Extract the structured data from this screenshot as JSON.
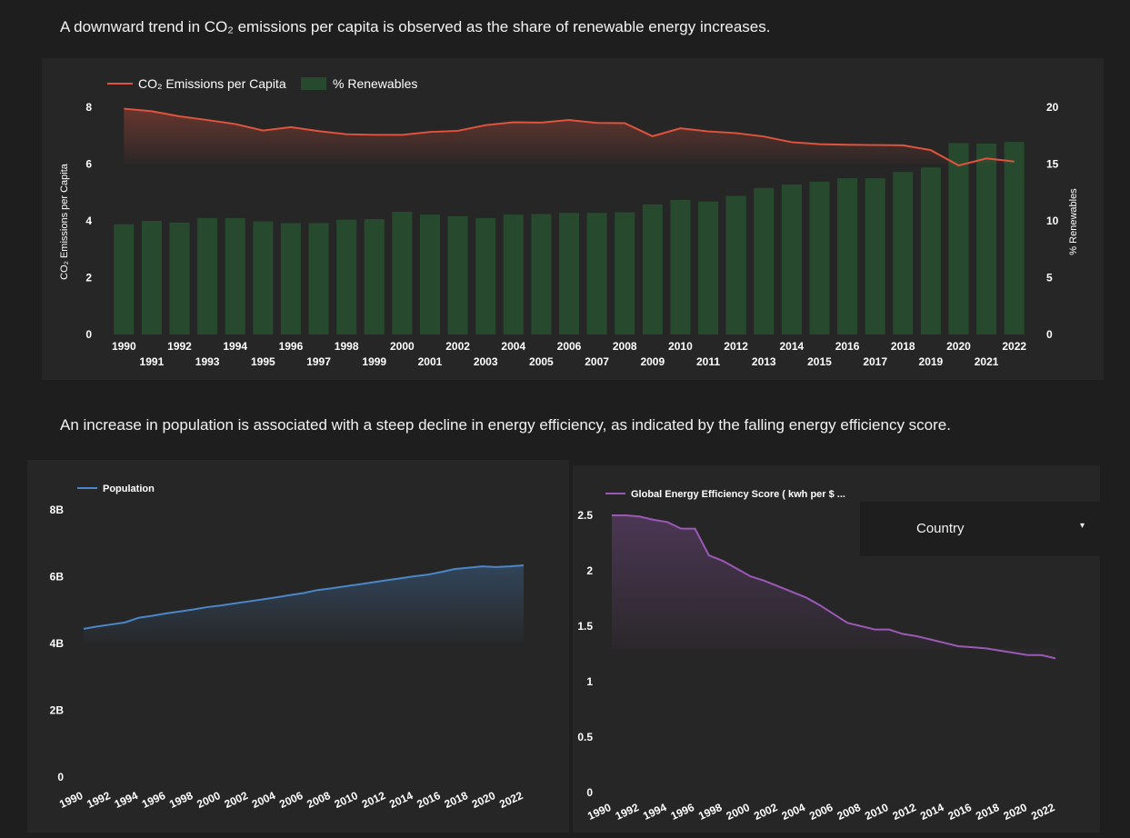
{
  "captions": {
    "top": "A downward trend in CO₂ emissions per capita is observed as the share of renewable energy increases.",
    "bottom": "An increase in population is associated with a  steep decline in energy efficiency, as indicated by the falling energy efficiency score."
  },
  "filter": {
    "label": "Country",
    "caret": "▾"
  },
  "colors": {
    "emissions_line": "#e0533d",
    "renewables_bar": "#274a2f",
    "population_line": "#4a86c8",
    "efficiency_line": "#9b59b6"
  },
  "chart_data": [
    {
      "type": "bar-line-combo",
      "title": "",
      "legend_position": "top-left",
      "categories": [
        "1990",
        "1991",
        "1992",
        "1993",
        "1994",
        "1995",
        "1996",
        "1997",
        "1998",
        "1999",
        "2000",
        "2001",
        "2002",
        "2003",
        "2004",
        "2005",
        "2006",
        "2007",
        "2008",
        "2009",
        "2010",
        "2011",
        "2012",
        "2013",
        "2014",
        "2015",
        "2016",
        "2017",
        "2018",
        "2019",
        "2020",
        "2021",
        "2022"
      ],
      "series": [
        {
          "name": "CO₂ Emissions per Capita",
          "type": "line",
          "axis": "left",
          "values": [
            7.95,
            7.86,
            7.68,
            7.55,
            7.41,
            7.18,
            7.3,
            7.16,
            7.05,
            7.03,
            7.03,
            7.13,
            7.17,
            7.37,
            7.47,
            7.46,
            7.55,
            7.45,
            7.44,
            6.98,
            7.26,
            7.15,
            7.09,
            6.97,
            6.77,
            6.7,
            6.68,
            6.67,
            6.66,
            6.49,
            5.95,
            6.2,
            6.09
          ]
        },
        {
          "name": "% Renewables",
          "type": "bar",
          "axis": "right",
          "values": [
            9.7,
            10.0,
            9.85,
            10.25,
            10.25,
            9.95,
            9.8,
            9.8,
            10.1,
            10.15,
            10.8,
            10.55,
            10.4,
            10.25,
            10.55,
            10.6,
            10.7,
            10.7,
            10.75,
            11.45,
            11.85,
            11.7,
            12.2,
            12.9,
            13.2,
            13.45,
            13.75,
            13.75,
            14.3,
            14.7,
            16.85,
            16.8,
            16.95
          ]
        }
      ],
      "y_left": {
        "label": "CO₂ Emissions per Capita",
        "ylim": [
          0,
          8
        ],
        "ticks": [
          "0",
          "2",
          "4",
          "6",
          "8"
        ]
      },
      "y_right": {
        "label": "% Renewables",
        "ylim": [
          0,
          20
        ],
        "ticks": [
          "0",
          "5",
          "10",
          "15",
          "20"
        ]
      }
    },
    {
      "type": "area",
      "title": "",
      "legend_position": "top-left",
      "x": [
        "1990",
        "1991",
        "1992",
        "1993",
        "1994",
        "1995",
        "1996",
        "1997",
        "1998",
        "1999",
        "2000",
        "2001",
        "2002",
        "2003",
        "2004",
        "2005",
        "2006",
        "2007",
        "2008",
        "2009",
        "2010",
        "2011",
        "2012",
        "2013",
        "2014",
        "2015",
        "2016",
        "2017",
        "2018",
        "2019",
        "2020",
        "2021",
        "2022"
      ],
      "x_ticks": [
        "1990",
        "1992",
        "1994",
        "1996",
        "1998",
        "2000",
        "2002",
        "2004",
        "2006",
        "2008",
        "2010",
        "2012",
        "2014",
        "2016",
        "2018",
        "2020",
        "2022"
      ],
      "series": [
        {
          "name": "Population",
          "values": [
            4.44,
            4.51,
            4.57,
            4.63,
            4.77,
            4.83,
            4.9,
            4.96,
            5.02,
            5.09,
            5.14,
            5.2,
            5.26,
            5.32,
            5.38,
            5.45,
            5.51,
            5.6,
            5.65,
            5.71,
            5.77,
            5.83,
            5.89,
            5.95,
            6.01,
            6.06,
            6.14,
            6.23,
            6.27,
            6.31,
            6.29,
            6.31,
            6.34
          ]
        }
      ],
      "ylim": [
        0,
        8
      ],
      "y_ticks": [
        "0",
        "2B",
        "4B",
        "6B",
        "8B"
      ]
    },
    {
      "type": "area",
      "title": "",
      "legend_position": "top-left",
      "x": [
        "1990",
        "1991",
        "1992",
        "1993",
        "1994",
        "1995",
        "1996",
        "1997",
        "1998",
        "1999",
        "2000",
        "2001",
        "2002",
        "2003",
        "2004",
        "2005",
        "2006",
        "2007",
        "2008",
        "2009",
        "2010",
        "2011",
        "2012",
        "2013",
        "2014",
        "2015",
        "2016",
        "2017",
        "2018",
        "2019",
        "2020",
        "2021",
        "2022"
      ],
      "x_ticks": [
        "1990",
        "1992",
        "1994",
        "1996",
        "1998",
        "2000",
        "2002",
        "2004",
        "2006",
        "2008",
        "2010",
        "2012",
        "2014",
        "2016",
        "2018",
        "2020",
        "2022"
      ],
      "series": [
        {
          "name": "Global Energy Efficiency Score ( kwh per $ ...",
          "values": [
            2.5,
            2.5,
            2.49,
            2.46,
            2.44,
            2.38,
            2.38,
            2.14,
            2.09,
            2.02,
            1.95,
            1.91,
            1.86,
            1.81,
            1.76,
            1.69,
            1.61,
            1.53,
            1.5,
            1.47,
            1.47,
            1.43,
            1.41,
            1.38,
            1.35,
            1.32,
            1.31,
            1.3,
            1.28,
            1.26,
            1.24,
            1.24,
            1.21
          ]
        }
      ],
      "ylim": [
        0,
        2.5
      ],
      "y_ticks": [
        "0",
        "0.5",
        "1",
        "1.5",
        "2",
        "2.5"
      ]
    }
  ]
}
